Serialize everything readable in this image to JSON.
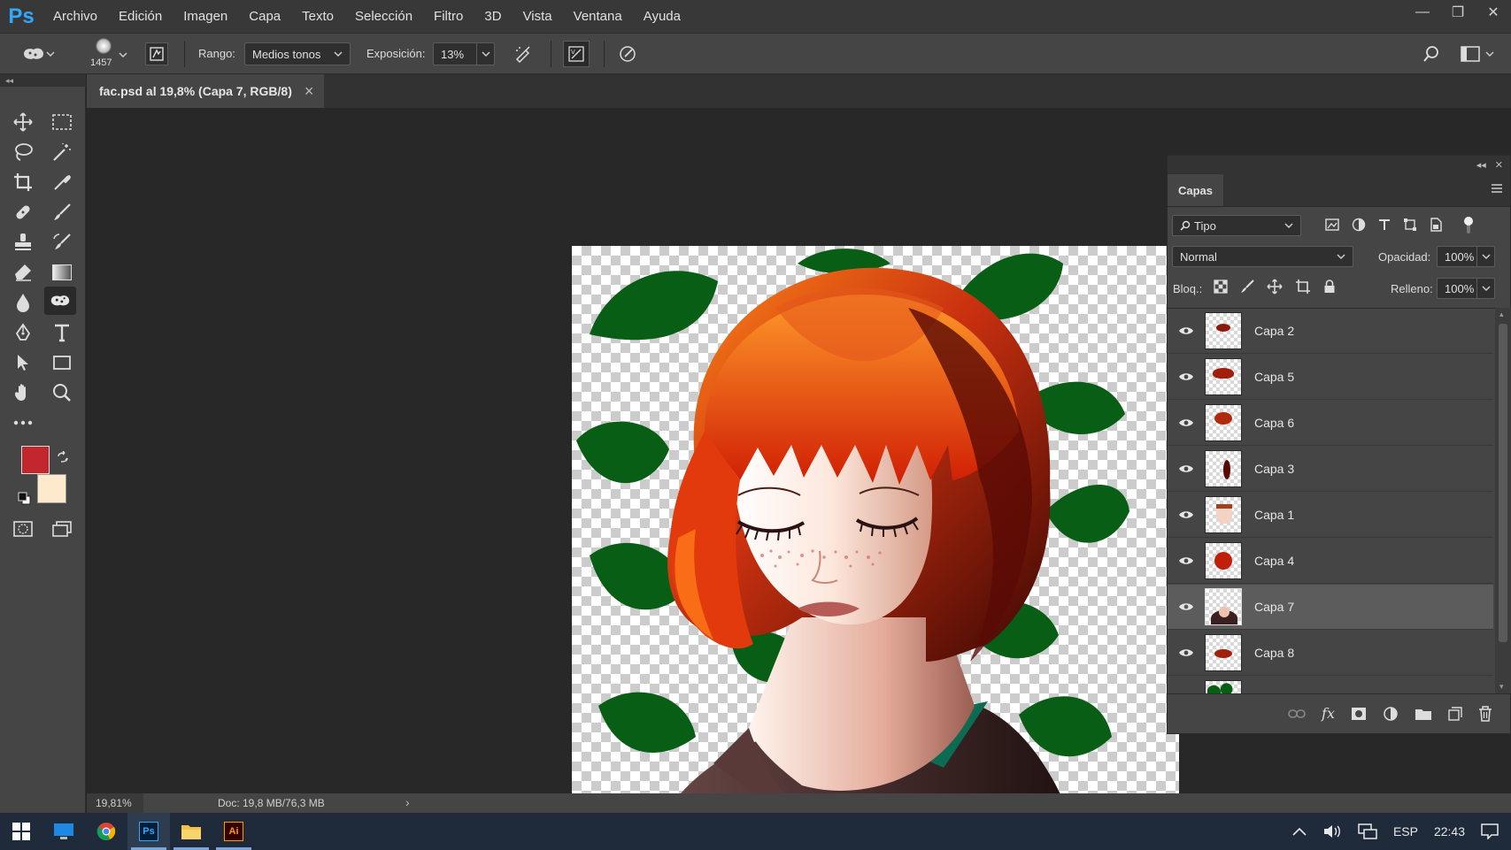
{
  "app": {
    "logo": "Ps",
    "menu": [
      "Archivo",
      "Edición",
      "Imagen",
      "Capa",
      "Texto",
      "Selección",
      "Filtro",
      "3D",
      "Vista",
      "Ventana",
      "Ayuda"
    ],
    "window_controls": [
      "—",
      "❐",
      "✕"
    ]
  },
  "options": {
    "brush_size": "1457",
    "range_label": "Rango:",
    "range_value": "Medios tonos",
    "exposure_label": "Exposición:",
    "exposure_value": "13%"
  },
  "document": {
    "tab_title": "fac.psd al 19,8% (Capa 7, RGB/8)",
    "tab_close": "×",
    "zoom": "19,81%",
    "doc_info": "Doc: 19,8 MB/76,3 MB"
  },
  "colors": {
    "foreground": "#c1272d",
    "background": "#fde9cc",
    "accent": "#31a8ff"
  },
  "layers_panel": {
    "tab": "Capas",
    "filter_kind": "Tipo",
    "blend_mode": "Normal",
    "opacity_label": "Opacidad:",
    "opacity_value": "100%",
    "lock_label": "Bloq.:",
    "fill_label": "Relleno:",
    "fill_value": "100%",
    "layers": [
      {
        "name": "Capa 2",
        "selected": false
      },
      {
        "name": "Capa 5",
        "selected": false
      },
      {
        "name": "Capa 6",
        "selected": false
      },
      {
        "name": "Capa 3",
        "selected": false
      },
      {
        "name": "Capa 1",
        "selected": false
      },
      {
        "name": "Capa 4",
        "selected": false
      },
      {
        "name": "Capa 7",
        "selected": true
      },
      {
        "name": "Capa 8",
        "selected": false
      }
    ]
  },
  "taskbar": {
    "ps_label": "Ps",
    "ai_label": "Ai",
    "language": "ESP",
    "time": "22:43"
  }
}
